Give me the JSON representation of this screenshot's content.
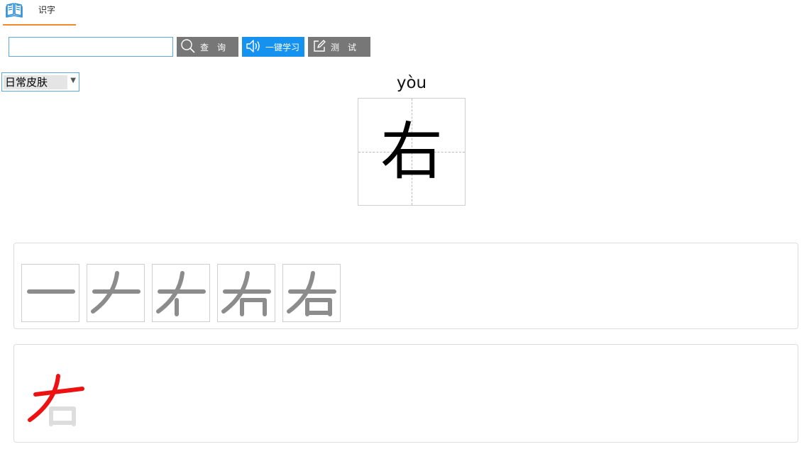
{
  "tabs": [
    {
      "label": "识字",
      "icon": "book-icon"
    }
  ],
  "search": {
    "value": "",
    "placeholder": ""
  },
  "toolbar": {
    "query_label": "查　询",
    "query_icon": "search-icon",
    "learn_label": "一键学习",
    "learn_icon": "speaker-icon",
    "test_label": "测　试",
    "test_icon": "edit-icon"
  },
  "skin_select": {
    "selected": "日常皮肤"
  },
  "character": {
    "pinyin": "yòu",
    "char": "右"
  },
  "stroke_order": {
    "steps": 5,
    "stroke_color": "#8c8c8c"
  },
  "animation": {
    "active_color": "#ee1111",
    "inactive_color": "#dddddd"
  },
  "colors": {
    "accent_tab": "#f0892a",
    "primary_button": "#1592ef",
    "secondary_button": "#777777",
    "input_border": "#5aa9e0"
  }
}
